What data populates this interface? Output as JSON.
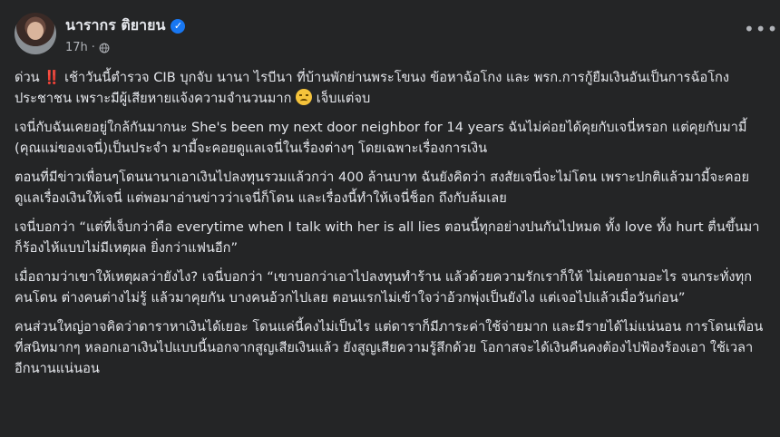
{
  "author": {
    "name": "นารากร ติยายน",
    "verified_mark": "✓",
    "time": "17h",
    "dot": "·"
  },
  "post": {
    "p1_start": "ด่วน ",
    "p1_alert": "‼️",
    "p1_rest": " เช้าวันนี้ตำรวจ CIB บุกจับ นานา ไรบีนา ที่บ้านพักย่านพระโขนง ข้อหาฉ้อโกง และ พรก.การกู้ยืมเงินอันเป็นการฉ้อโกงประชาชน  เพราะมีผู้เสียหายแจ้งความจำนวนมาก ",
    "p1_end": " เจ็บแต่จบ",
    "p2": "เจนี่กับฉันเคยอยู่ใกล้กันมากนะ She's been my next door neighbor for 14 years ฉันไม่ค่อยได้คุยกับเจนี่หรอก แต่คุยกับมามี้ (คุณแม่ของเจนี่)เป็นประจำ  มามี้จะคอยดูแลเจนี่ในเรื่องต่างๆ โดยเฉพาะเรื่องการเงิน",
    "p3": "ตอนที่มีข่าวเพื่อนๆโดนนานาเอาเงินไปลงทุนรวมแล้วกว่า 400 ล้านบาท ฉันยังคิดว่า สงสัยเจนี่จะไม่โดน เพราะปกติแล้วมามี้จะคอยดูแลเรื่องเงินให้เจนี่ แต่พอมาอ่านข่าวว่าเจนี่ก็โดน  และเรื่องนี้ทำให้เจนี่ช็อก  ถึงกับล้มเลย",
    "p4": "เจนี่บอกว่า “แต่ที่เจ็บกว่าคือ everytime when I talk with her is all lies ตอนนี้ทุกอย่างปนกันไปหมด ทั้ง love ทั้ง hurt ตื่นขึ้นมาก็ร้องไห้แบบไม่มีเหตุผล ยิ่งกว่าแฟนอีก”",
    "p5": "เมื่อถามว่าเขาให้เหตุผลว่ายังไง? เจนี่บอกว่า “เขาบอกว่าเอาไปลงทุนทำร้าน แล้วด้วยความรักเราก็ให้ ไม่เคยถามอะไร จนกระทั่งทุกคนโดน ต่างคนต่างไม่รู้ แล้วมาคุยกัน บางคนอ้วกไปเลย  ตอนแรกไม่เข้าใจว่าอ้วกพุ่งเป็นยังไง แต่เจอไปแล้วเมื่อวันก่อน”",
    "p6": "คนส่วนใหญ่อาจคิดว่าดาราหาเงินได้เยอะ โดนแค่นี้คงไม่เป็นไร  แต่ดาราก็มีภาระค่าใช้จ่ายมาก  และมีรายได้ไม่แน่นอน การโดนเพื่อนที่สนิทมากๆ หลอกเอาเงินไปแบบนี้นอกจากสูญเสียเงินแล้ว  ยังสูญเสียความรู้สึกด้วย โอกาสจะได้เงินคืนคงต้องไปฟ้องร้องเอา  ใช้เวลาอีกนานแน่นอน"
  },
  "icons": {
    "more": "more-options-icon",
    "globe": "globe-icon",
    "sad": "sad-face-emoji"
  },
  "colors": {
    "background": "#242526",
    "text": "#e4e6eb",
    "secondary": "#b0b3b8",
    "verified": "#1877f2"
  }
}
